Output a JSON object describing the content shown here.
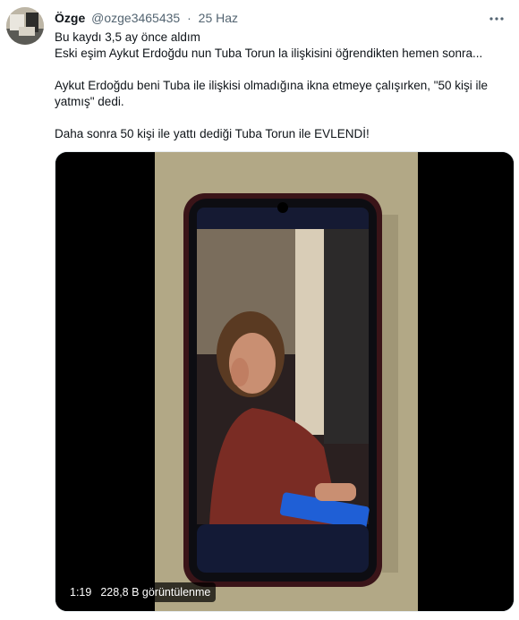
{
  "author": {
    "display_name": "Özge",
    "handle": "@ozge3465435",
    "separator": "·",
    "date": "25 Haz"
  },
  "tweet": {
    "lines": {
      "l1": "Bu kaydı 3,5 ay önce aldım",
      "l2": "Eski eşim Aykut Erdoğdu nun Tuba Torun la ilişkisini öğrendikten hemen sonra...",
      "l3": "Aykut Erdoğdu beni Tuba ile ilişkisi olmadığına ikna etmeye çalışırken, \"50 kişi ile",
      "l4": "yatmış\" dedi.",
      "l5": "Daha sonra 50 kişi ile yattı dediği Tuba Torun ile EVLENDİ!"
    }
  },
  "video": {
    "duration": "1:19",
    "views": "228,8 B görüntülenme"
  },
  "icons": {
    "more": "more-horizontal-icon"
  }
}
